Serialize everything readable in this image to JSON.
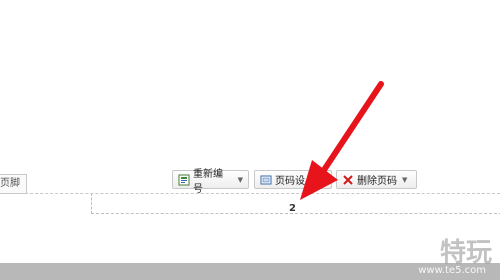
{
  "footer": {
    "label": "页脚",
    "page_number": "2"
  },
  "toolbar": {
    "renumber_label": "重新编号",
    "settings_label": "页码设",
    "delete_label": "删除页码"
  },
  "watermark": {
    "logo_text": "特玩",
    "url": "www.te5.com"
  },
  "colors": {
    "arrow": "#e8141b",
    "bottom_bar": "#b8b8b8"
  }
}
